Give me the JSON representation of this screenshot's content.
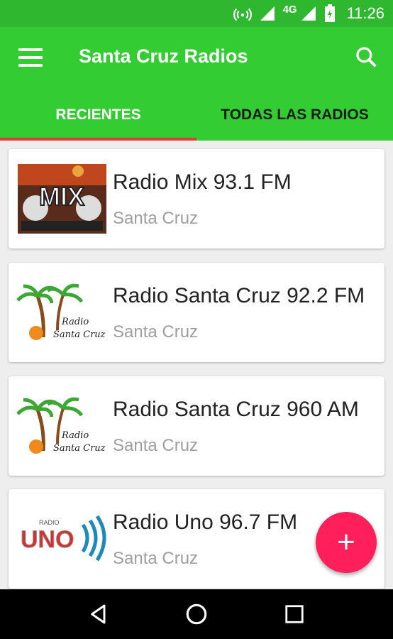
{
  "status_bar": {
    "network": "4G",
    "time": "11:26"
  },
  "toolbar": {
    "title": "Santa Cruz Radios"
  },
  "tabs": [
    {
      "label": "RECIENTES",
      "active": true
    },
    {
      "label": "TODAS LAS RADIOS",
      "active": false
    }
  ],
  "stations": [
    {
      "name": "Radio Mix 93.1 FM",
      "city": "Santa Cruz",
      "logo": "mix-logo",
      "logo_text": "MIX"
    },
    {
      "name": "Radio Santa Cruz 92.2 FM",
      "city": "Santa Cruz",
      "logo": "palm-tree-logo",
      "logo_text": "Radio Santa Cruz"
    },
    {
      "name": "Radio Santa Cruz 960 AM",
      "city": "Santa Cruz",
      "logo": "palm-tree-logo",
      "logo_text": "Radio Santa Cruz"
    },
    {
      "name": "Radio Uno 96.7 FM",
      "city": "Santa Cruz",
      "logo": "uno-logo",
      "logo_text": "UNO"
    }
  ],
  "fab": {
    "icon": "plus-icon",
    "label": "+"
  },
  "colors": {
    "primary": "#33cc33",
    "status": "#2fb82f",
    "accent": "#ff1f5a",
    "indicator": "#e53935"
  }
}
